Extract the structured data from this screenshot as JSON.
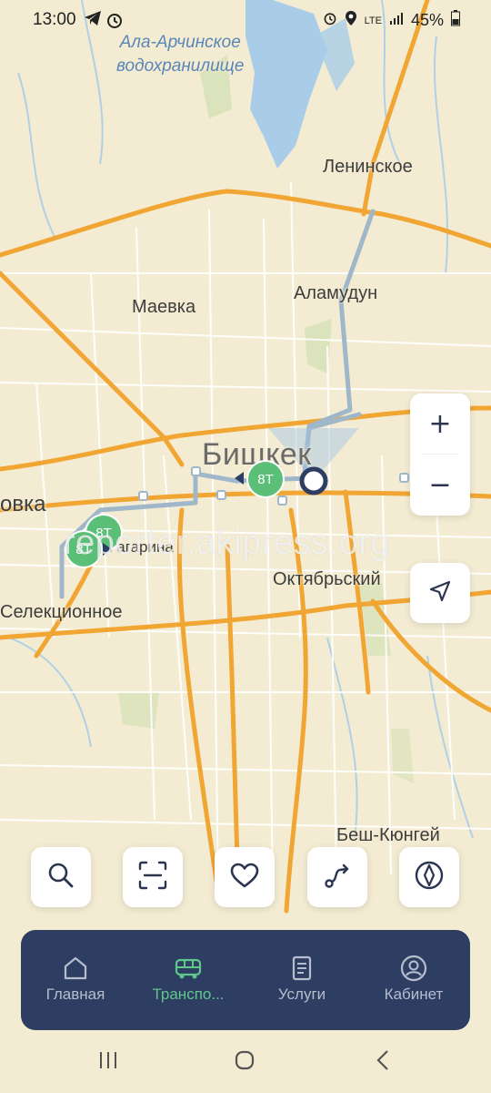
{
  "status_bar": {
    "time": "13:00",
    "battery": "45%",
    "network": "LTE"
  },
  "map": {
    "labels": {
      "reservoir": "Ала-Арчинское\nводохранилище",
      "leninskoe": "Ленинское",
      "maevka": "Маевка",
      "alamudun": "Аламудун",
      "bishkek": "Бишкек",
      "ovka": "овка",
      "gagarina": "Гагарина",
      "oktyabrsky": "Октябрьский",
      "selektsionnoe": "Селекционное",
      "besh_kyungey": "Беш-Кюнгей"
    },
    "buses": [
      {
        "route": "8Т"
      },
      {
        "route": "8Т"
      },
      {
        "route": "8Т"
      }
    ]
  },
  "watermark": "reporter.akipress.org",
  "zoom": {
    "in": "+",
    "out": "−"
  },
  "nav": {
    "items": [
      {
        "label": "Главная",
        "icon": "home-icon"
      },
      {
        "label": "Транспо...",
        "icon": "bus-icon"
      },
      {
        "label": "Услуги",
        "icon": "document-icon"
      },
      {
        "label": "Кабинет",
        "icon": "user-icon"
      }
    ],
    "active": 1
  },
  "colors": {
    "nav_bg": "#2e3e63",
    "accent": "#5fc78a",
    "route": "#9fb7c9",
    "road_major": "#f1a533",
    "map_bg": "#f3ecd2",
    "water": "#a9cde8"
  }
}
